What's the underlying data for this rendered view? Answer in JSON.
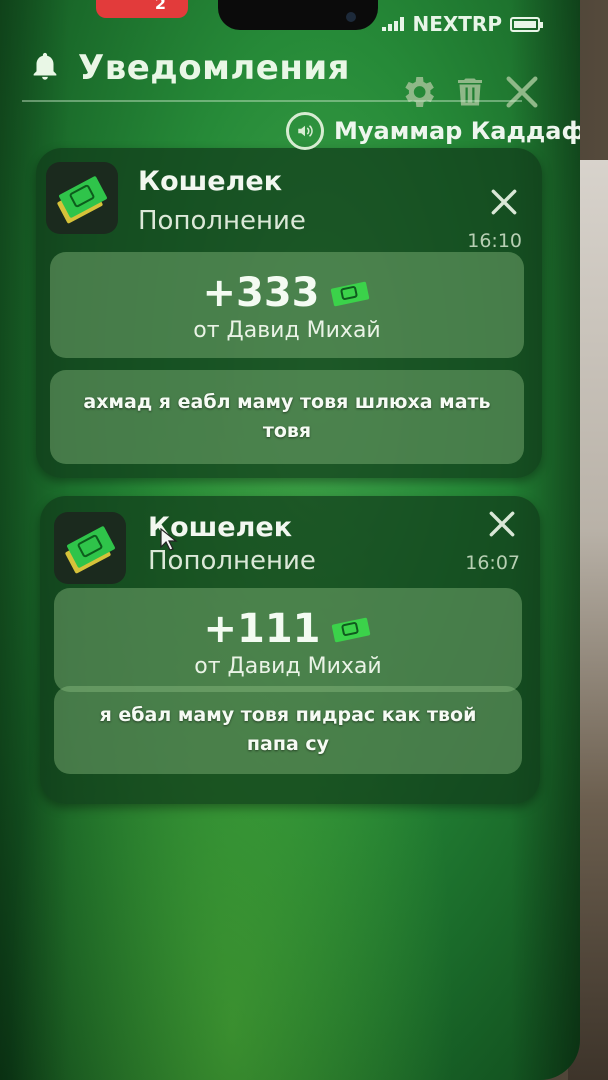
{
  "status_bar": {
    "badge_count": "2",
    "carrier": "NEXTRP"
  },
  "header": {
    "title": "Уведомления",
    "icons": [
      "bell-icon",
      "gear-icon",
      "trash-icon",
      "close-icon"
    ]
  },
  "caller": {
    "name": "Муаммар Каддафи",
    "icon": "speaker-icon"
  },
  "notifications": [
    {
      "app": "Кошелек",
      "subtitle": "Пополнение",
      "time": "16:10",
      "amount": "+333",
      "from": "от Давид Михай",
      "message": "ахмад я еабл маму товя шлюха мать товя"
    },
    {
      "app": "Кошелек",
      "subtitle": "Пополнение",
      "time": "16:07",
      "amount": "+111",
      "from": "от Давид Михай",
      "message": "я ебал маму товя пидрас как твой папа су"
    }
  ],
  "colors": {
    "screen_green": "#268a38",
    "card_bg": "#103c1a",
    "badge_red": "#e23b3b",
    "money_green": "#3bd24a"
  }
}
